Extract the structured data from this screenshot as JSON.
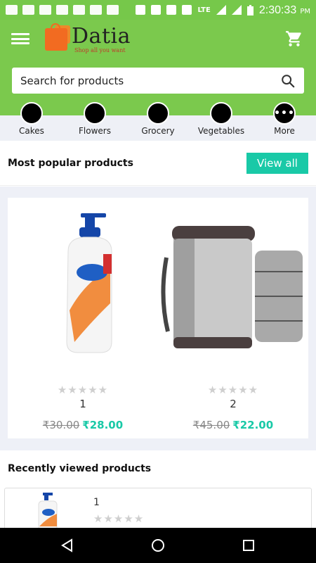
{
  "status_bar": {
    "network": "LTE",
    "time": "2:30:33",
    "ampm": "PM"
  },
  "header": {
    "app_name": "Datia",
    "tagline": "Shop all you want"
  },
  "search": {
    "placeholder": "Search for products"
  },
  "categories": [
    {
      "label": "Cakes"
    },
    {
      "label": "Flowers"
    },
    {
      "label": "Grocery"
    },
    {
      "label": "Vegetables"
    },
    {
      "label": "More"
    }
  ],
  "popular": {
    "title": "Most popular products",
    "view_all_label": "View all",
    "products": [
      {
        "name": "1",
        "old_price": "₹30.00",
        "new_price": "₹28.00",
        "stars": "★★★★★"
      },
      {
        "name": "2",
        "old_price": "₹45.00",
        "new_price": "₹22.00",
        "stars": "★★★★★"
      }
    ]
  },
  "recent": {
    "title": "Recently viewed products",
    "items": [
      {
        "name": "1",
        "stars": "★★★★★"
      }
    ]
  },
  "colors": {
    "brand_green": "#7bc94d",
    "accent": "#19c9a7",
    "logo_orange": "#f26b21"
  }
}
